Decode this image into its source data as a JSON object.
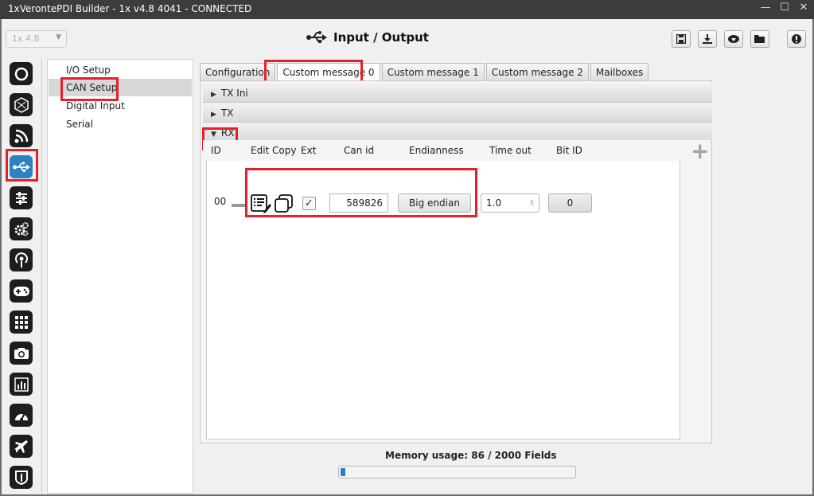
{
  "window": {
    "title": "1xVerontePDI Builder - 1x v4.8 4041 - CONNECTED"
  },
  "header": {
    "version_select": "1x 4.8",
    "title": "Input / Output"
  },
  "nav": {
    "items": [
      "I/O Setup",
      "CAN Setup",
      "Digital Input",
      "Serial"
    ],
    "selected": "CAN Setup"
  },
  "tabs": [
    "Configuration",
    "Custom message 0",
    "Custom message 1",
    "Custom message 2",
    "Mailboxes"
  ],
  "active_tab": "Custom message 0",
  "sections": {
    "tx_ini": "TX Ini",
    "tx": "TX",
    "rx": "RX"
  },
  "rx": {
    "columns": {
      "id": "ID",
      "edit": "Edit",
      "copy": "Copy",
      "ext": "Ext",
      "can_id": "Can id",
      "endianness": "Endianness",
      "time_out": "Time out",
      "bit_id": "Bit ID"
    },
    "row": {
      "id": "00",
      "ext_checked": true,
      "can_id": "589826",
      "endianness": "Big endian",
      "time_out": "1.0",
      "time_unit": "s",
      "bit_id": "0"
    }
  },
  "memory": {
    "label": "Memory usage: 86 / 2000 Fields",
    "used": 86,
    "total": 2000
  },
  "colors": {
    "accent": "#2e80c0",
    "highlight": "#e3202b",
    "progress": "#2d7dc9"
  }
}
